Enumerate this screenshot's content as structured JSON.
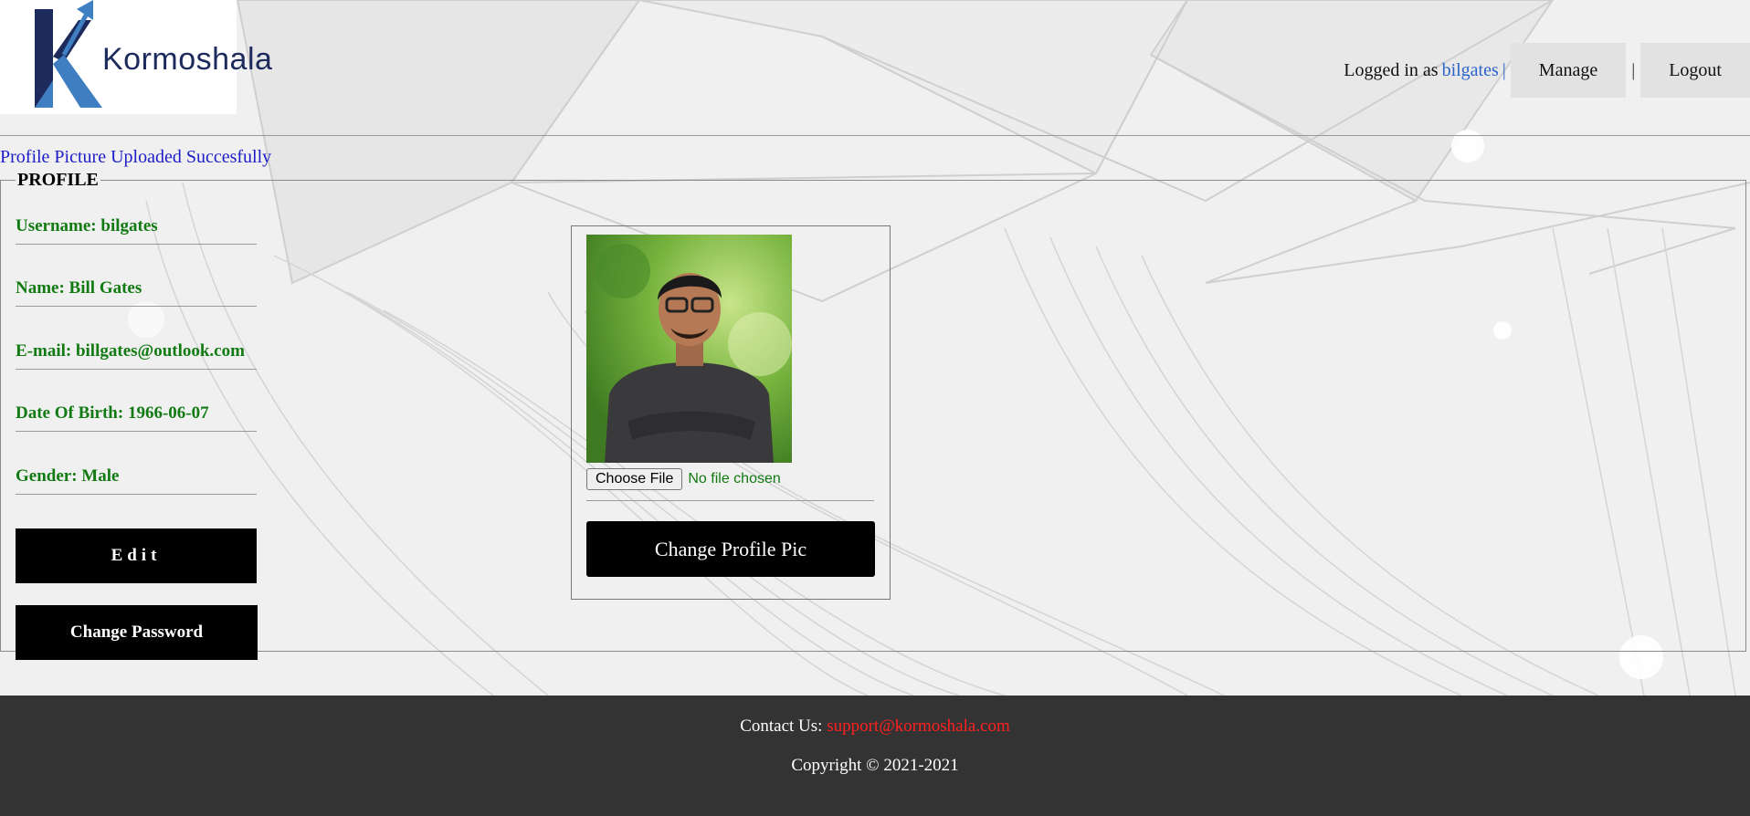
{
  "brand": {
    "name": "Kormoshala"
  },
  "header": {
    "logged_in_text": "Logged in as",
    "username": "bilgates",
    "pipe": "|",
    "nav": [
      {
        "label": "Manage"
      },
      {
        "label": "Logout"
      }
    ],
    "separator": "|"
  },
  "flash_message": "Profile Picture Uploaded Succesfully",
  "profile": {
    "legend": "PROFILE",
    "fields": {
      "username": "Username: bilgates",
      "name": "Name: Bill Gates",
      "email": "E-mail: billgates@outlook.com",
      "dob": "Date Of Birth: 1966-06-07",
      "gender": "Gender: Male"
    },
    "edit_label": "Edit",
    "change_password_label": "Change Password",
    "picture": {
      "choose_file_label": "Choose File",
      "file_status": "No file chosen",
      "change_pic_label": "Change Profile Pic"
    }
  },
  "footer": {
    "contact_label": "Contact Us:",
    "contact_email": "support@kormoshala.com",
    "copyright": "Copyright © 2021-2021"
  },
  "colors": {
    "field_text": "#127a12",
    "link_blue": "#2b63c9",
    "flash_blue": "#1c1cc9",
    "footer_bg": "#333333",
    "footer_link": "#ff2020"
  },
  "icons": {
    "logo": "kormoshala-k-arrow-logo"
  }
}
